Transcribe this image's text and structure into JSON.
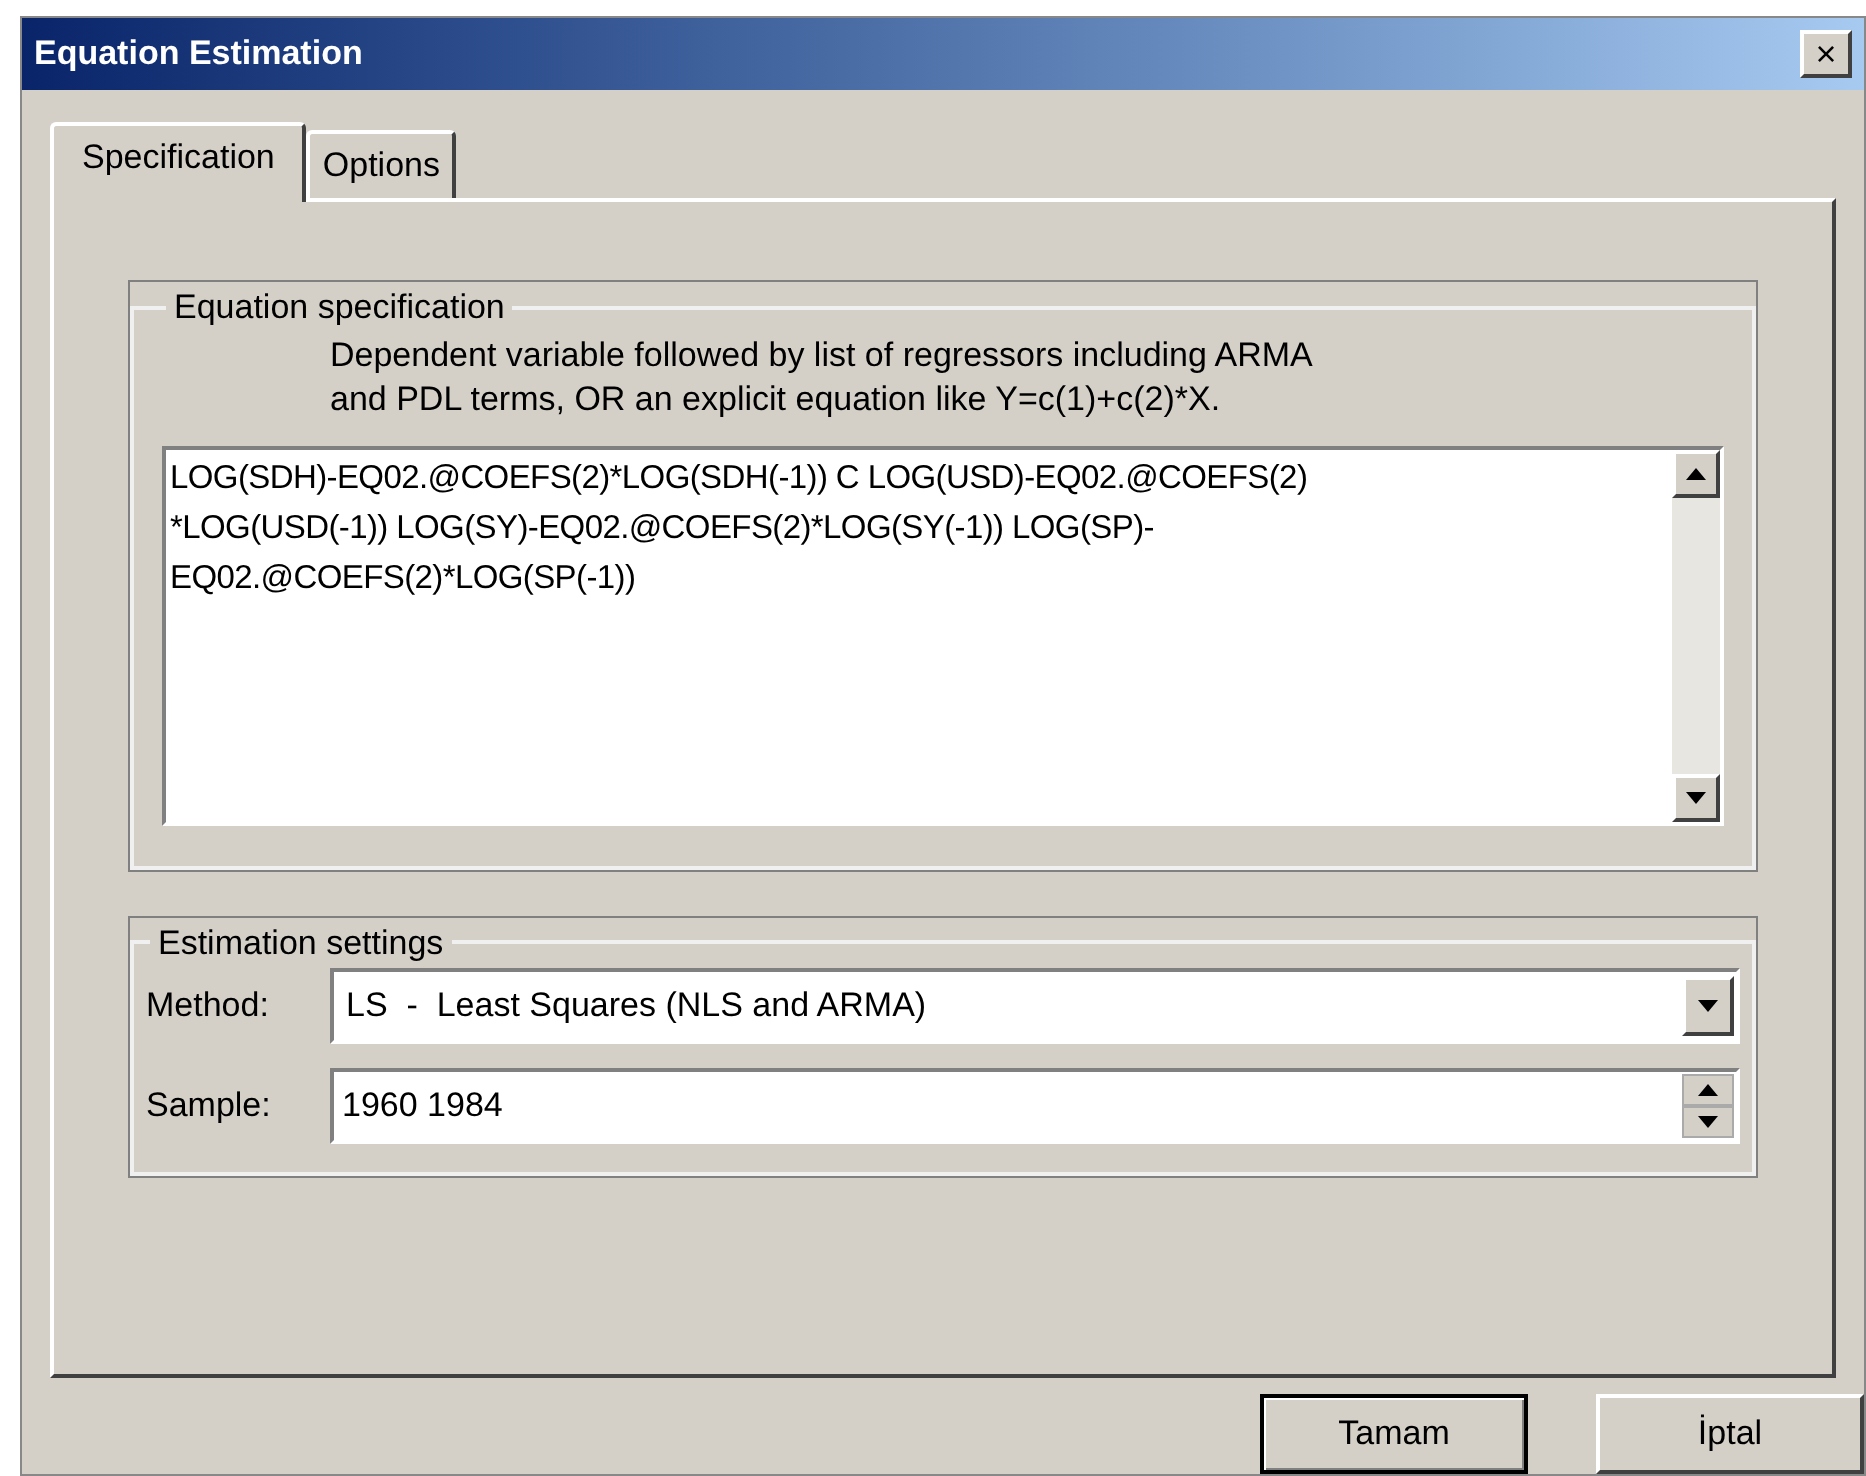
{
  "window": {
    "title": "Equation Estimation",
    "close": "×"
  },
  "tabs": [
    {
      "label": "Specification",
      "selected": true
    },
    {
      "label": "Options",
      "selected": false
    }
  ],
  "equation_specification": {
    "legend": "Equation specification",
    "hint_lines": [
      "Dependent variable followed by list of regressors including ARMA",
      "and PDL terms, OR an explicit equation like Y=c(1)+c(2)*X."
    ],
    "value_lines": [
      "LOG(SDH)-EQ02.@COEFS(2)*LOG(SDH(-1)) C LOG(USD)-EQ02.@COEFS(2)",
      "*LOG(USD(-1)) LOG(SY)-EQ02.@COEFS(2)*LOG(SY(-1)) LOG(SP)-",
      "EQ02.@COEFS(2)*LOG(SP(-1))"
    ]
  },
  "estimation_settings": {
    "legend": "Estimation settings",
    "method": {
      "label": "Method:",
      "value": "LS  -  Least Squares (NLS and ARMA)"
    },
    "sample": {
      "label": "Sample:",
      "value": "1960 1984"
    }
  },
  "buttons": [
    "Tamam",
    "İptal"
  ]
}
